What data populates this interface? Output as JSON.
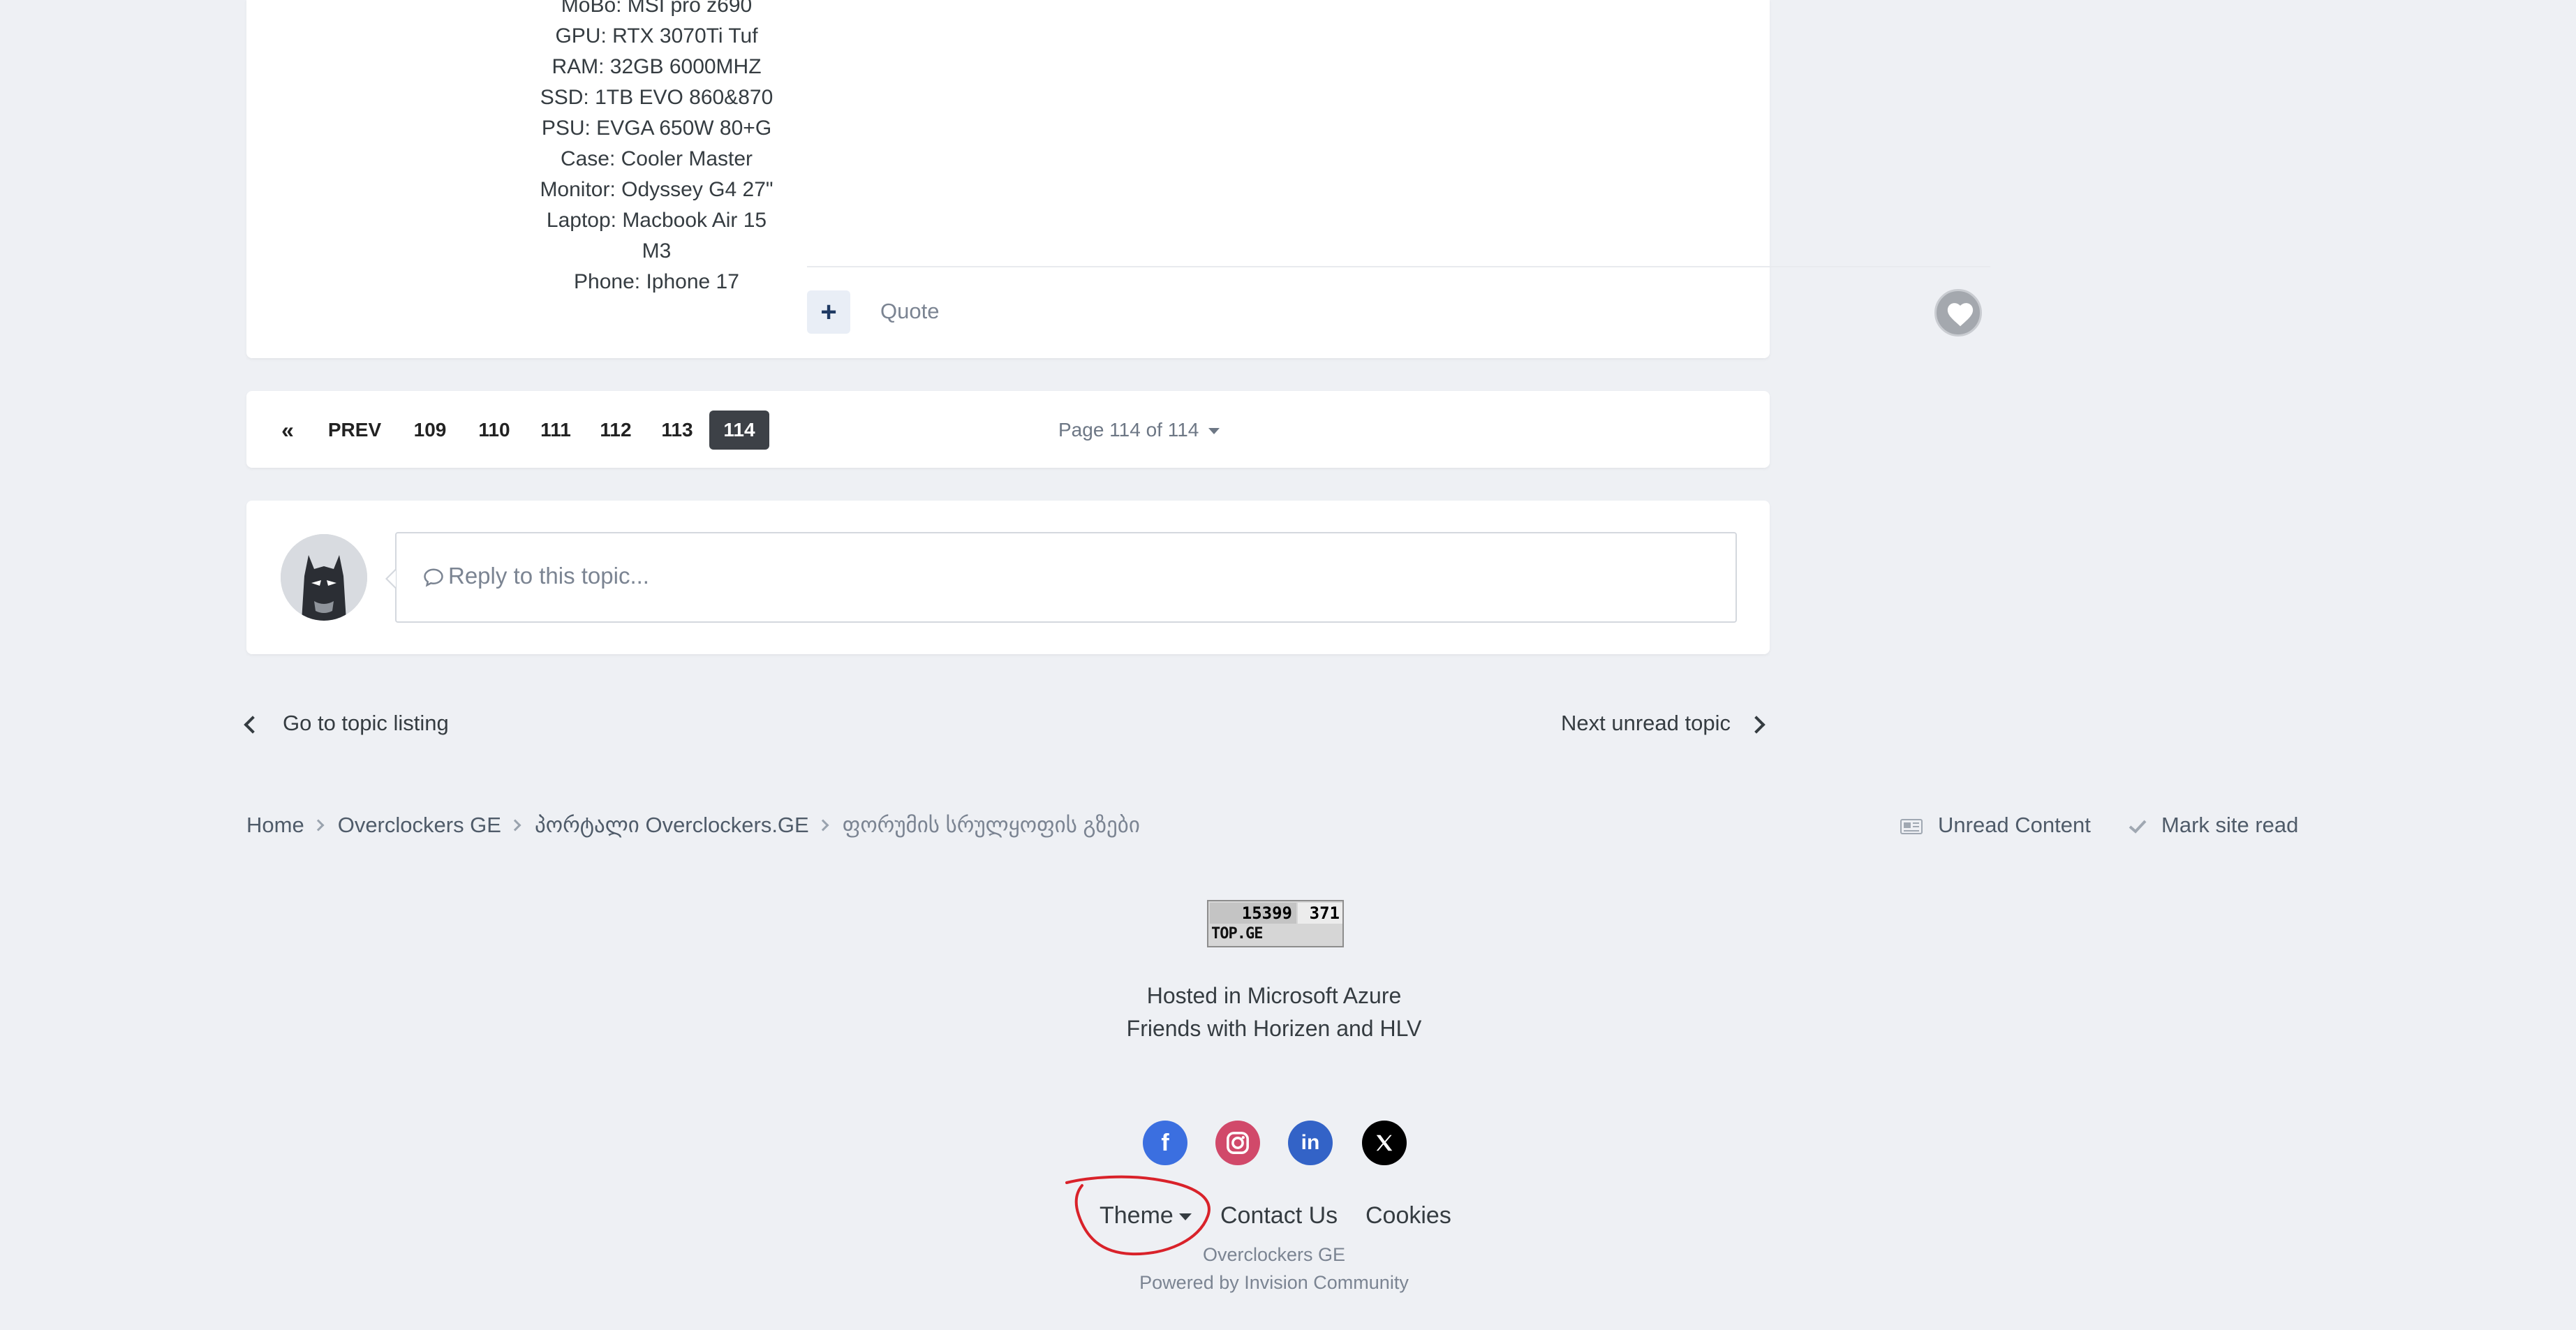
{
  "post": {
    "specs": [
      "MoBo: MSI pro z690",
      "GPU: RTX 3070Ti Tuf",
      "RAM: 32GB 6000MHZ",
      "SSD: 1TB EVO 860&870",
      "PSU: EVGA 650W 80+G",
      "Case: Cooler Master",
      "Monitor: Odyssey G4 27\"",
      "Laptop: Macbook Air 15 M3",
      "Phone: Iphone 17"
    ],
    "plus_label": "+",
    "quote_label": "Quote",
    "like_icon": "heart-icon"
  },
  "pagination": {
    "first_icon": "«",
    "prev_label": "PREV",
    "pages": [
      "109",
      "110",
      "111",
      "112",
      "113",
      "114"
    ],
    "active_page": "114",
    "jump_label": "Page 114 of 114"
  },
  "reply": {
    "placeholder": "Reply to this topic..."
  },
  "topic_nav": {
    "back_label": "Go to topic listing",
    "next_label": "Next unread topic"
  },
  "breadcrumb": {
    "items": [
      "Home",
      "Overclockers GE",
      "პორტალი Overclockers.GE",
      "ფორუმის სრულყოფის გზები"
    ]
  },
  "quick_links": {
    "unread_label": "Unread Content",
    "mark_read_label": "Mark site read"
  },
  "counter": {
    "hits": "15399",
    "hosts": "371",
    "brand": "TOP.GE"
  },
  "footer": {
    "hosted": "Hosted in Microsoft Azure",
    "friends": "Friends with Horizen and HLV",
    "social": [
      {
        "name": "facebook",
        "glyph": "f",
        "color": "#3b6fe0"
      },
      {
        "name": "instagram",
        "glyph": "◎",
        "color": "#d1496a"
      },
      {
        "name": "linkedin",
        "glyph": "in",
        "color": "#3363c7"
      },
      {
        "name": "x",
        "glyph": "𝕏",
        "color": "#000000"
      }
    ],
    "theme_label": "Theme",
    "contact_label": "Contact Us",
    "cookies_label": "Cookies",
    "site_name": "Overclockers GE",
    "powered_by": "Powered by Invision Community"
  },
  "annotation_color": "#d9222a"
}
